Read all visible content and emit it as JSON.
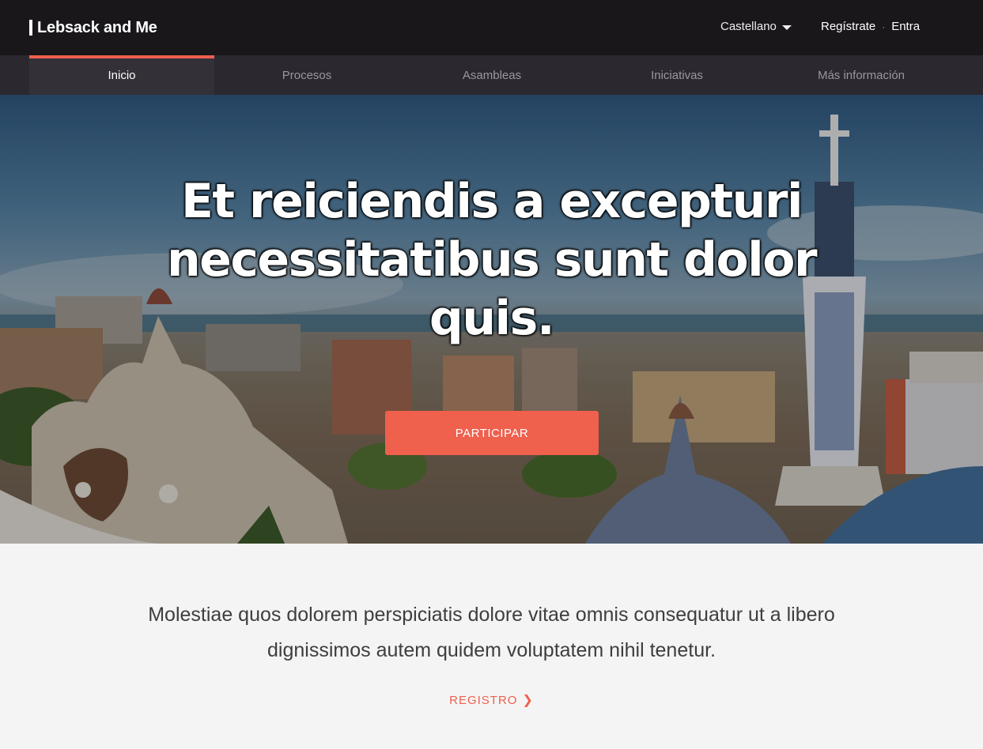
{
  "header": {
    "brand": "Lebsack and Me",
    "language": "Castellano",
    "register_link": "Regístrate",
    "separator": "·",
    "login_link": "Entra"
  },
  "nav": {
    "items": [
      {
        "label": "Inicio",
        "active": true
      },
      {
        "label": "Procesos",
        "active": false
      },
      {
        "label": "Asambleas",
        "active": false
      },
      {
        "label": "Iniciativas",
        "active": false
      },
      {
        "label": "Más información",
        "active": false
      }
    ]
  },
  "hero": {
    "title": "Et reiciendis a excepturi necessitatibus sunt dolor quis.",
    "cta_label": "PARTICIPAR"
  },
  "intro": {
    "text": "Molestiae quos dolorem perspiciatis dolore vitae omnis consequatur ut a libero dignissimos autem quidem voluptatem nihil tenetur.",
    "register_label": "REGISTRO",
    "register_icon": "chevron-right-icon"
  },
  "colors": {
    "accent": "#ef604d",
    "topbar": "#1a171b",
    "nav": "#2b2830",
    "background": "#f4f4f4"
  }
}
